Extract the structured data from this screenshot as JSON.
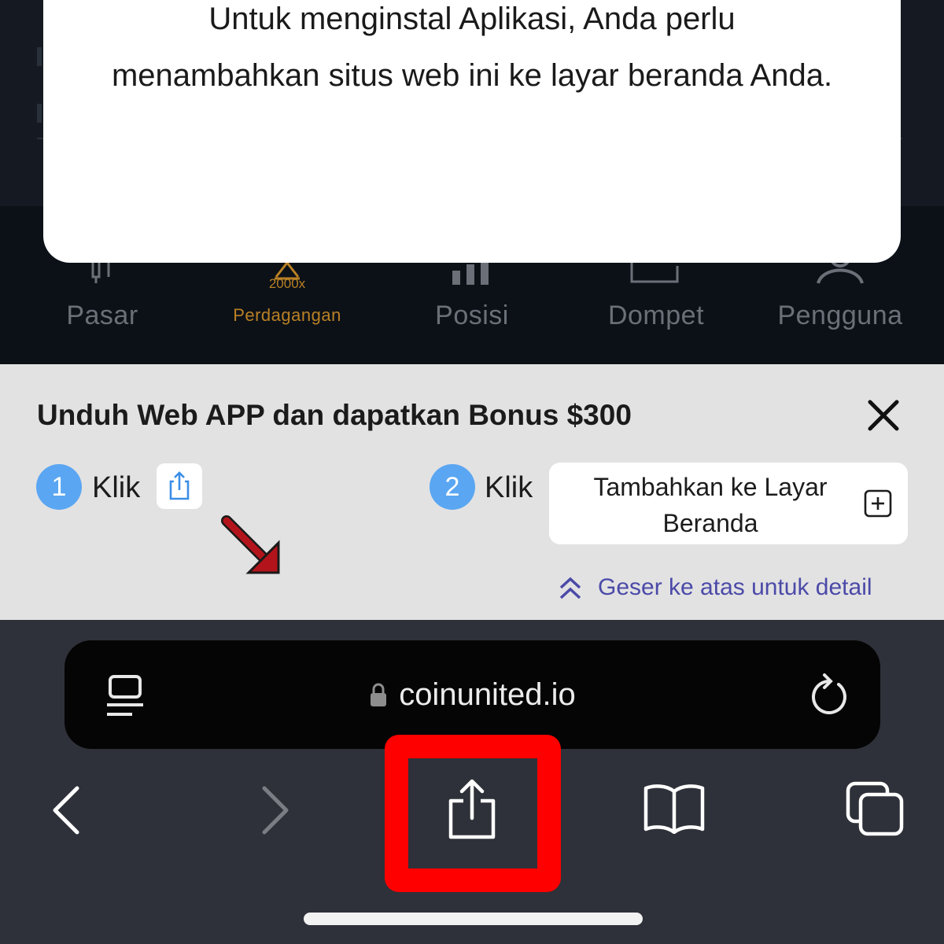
{
  "modal": {
    "message": "Untuk menginstal Aplikasi, Anda perlu menambahkan situs web ini ke layar beranda Anda."
  },
  "tab_bar": {
    "tabs": [
      {
        "label": "Pasar",
        "icon": "candlestick-chart-icon",
        "active": false
      },
      {
        "label": "Perdagangan",
        "icon": "trade-triangle-icon",
        "active": true,
        "badge": "2000x"
      },
      {
        "label": "Posisi",
        "icon": "bar-chart-icon",
        "active": false
      },
      {
        "label": "Dompet",
        "icon": "wallet-icon",
        "active": false
      },
      {
        "label": "Pengguna",
        "icon": "user-icon",
        "active": false
      }
    ],
    "active_color": "#b98024",
    "inactive_color": "#6b7078"
  },
  "banner": {
    "title": "Unduh Web APP dan dapatkan Bonus $300",
    "step1": {
      "number": "1",
      "text": "Klik",
      "icon": "share-icon"
    },
    "step2": {
      "number": "2",
      "text": "Klik",
      "button_label": "Tambahkan ke Layar Beranda",
      "icon": "add-square-icon"
    },
    "detail_link": "Geser ke atas untuk detail",
    "accent_color": "#5aa6f2"
  },
  "browser": {
    "url": "coinunited.io",
    "toolbar": [
      "back-icon",
      "forward-icon",
      "share-icon",
      "bookmarks-icon",
      "tabs-icon"
    ],
    "highlight_color": "#ff0000"
  }
}
